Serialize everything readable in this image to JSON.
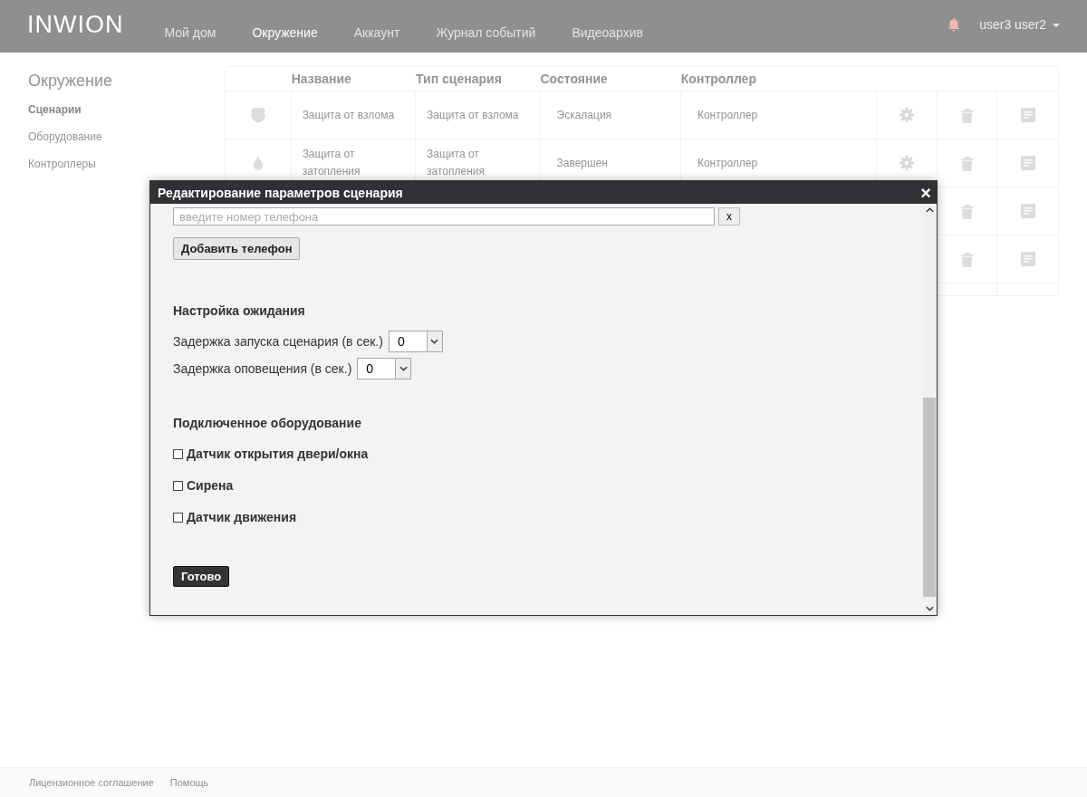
{
  "header": {
    "logo": "INWION",
    "nav": [
      {
        "label": "Мой дом",
        "selected": false
      },
      {
        "label": "Окружение",
        "selected": true
      },
      {
        "label": "Аккаунт",
        "selected": false
      },
      {
        "label": "Журнал событий",
        "selected": false
      },
      {
        "label": "Видеоархив",
        "selected": false
      }
    ],
    "user": "user3 user2"
  },
  "sidebar": {
    "title": "Окружение",
    "items": [
      {
        "label": "Сценарии",
        "selected": true
      },
      {
        "label": "Оборудование",
        "selected": false
      },
      {
        "label": "Контроллеры",
        "selected": false
      }
    ]
  },
  "table": {
    "columns": [
      "Название",
      "Тип сценария",
      "Состояние",
      "Контроллер"
    ],
    "rows": [
      {
        "kind": "shield",
        "name": "Защита от взлома",
        "type": "Защита от взлома",
        "state": "Эскалация",
        "controller": "Контроллер"
      },
      {
        "kind": "drop",
        "name": "Защита от затопления",
        "type": "Защита от затопления",
        "state": "Завершен",
        "controller": "Контроллер"
      },
      {
        "kind": "hidden"
      },
      {
        "kind": "hidden"
      }
    ]
  },
  "modal": {
    "title": "Редактирование параметров сценария",
    "close": "×",
    "phone": {
      "placeholder": "введите номер телефона",
      "remove": "x"
    },
    "add_phone": "Добавить телефон",
    "wait_title": "Настройка ожидания",
    "delays": [
      {
        "label": "Задержка запуска сценария (в сек.)",
        "value": "0"
      },
      {
        "label": "Задержка оповещения (в сек.)",
        "value": "0"
      }
    ],
    "equipment_title": "Подключенное оборудование",
    "equipment": [
      {
        "label": "Датчик открытия двери/окна",
        "checked": false
      },
      {
        "label": "Сирена",
        "checked": false
      },
      {
        "label": "Датчик движения",
        "checked": false
      }
    ],
    "done": "Готово"
  },
  "footer": {
    "links": [
      "Лицензионное соглашение",
      "Помощь"
    ]
  }
}
